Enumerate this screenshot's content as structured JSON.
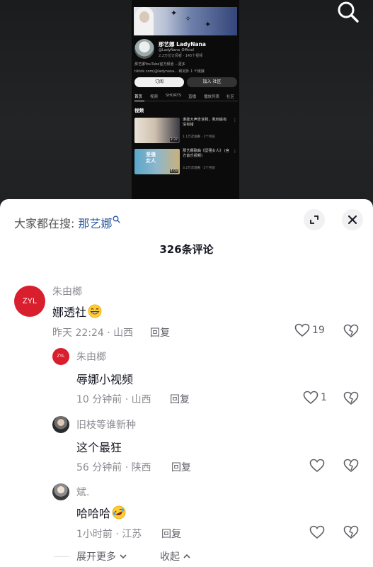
{
  "video": {
    "channel_name": "那艺娜 LadyNana",
    "handle": "@LadyNana_Official",
    "stats": "2.2万位订阅者 · 145个视频",
    "description": "那艺娜YouTube官方频道 ...更多",
    "link": "tiktok.com/@ladynana... 和另外 1 个链接",
    "subscribe_label": "订阅",
    "join_label": "加入 社区",
    "tabs": [
      "首页",
      "视频",
      "SHORTS",
      "直播",
      "播放列表",
      "社区"
    ],
    "section_title": "视频",
    "videos": [
      {
        "title": "谁能大声告诉我，我到底有没有错",
        "meta": "1.1万次观看 · 1个月前",
        "duration": "2:37",
        "thumb_text": ""
      },
      {
        "title": "那艺娜歌曲《坚强女人》 (官方音乐视频)",
        "meta": "3.2万次观看 · 2个月前",
        "duration": "4:03",
        "thumb_text": "坚强\n女人"
      }
    ]
  },
  "sheet": {
    "everyone_searching_prefix": "大家都在搜:",
    "search_term": "那艺娜",
    "comment_count": "326条评论"
  },
  "comments": [
    {
      "avatar_text": "ZYL",
      "username": "朱由榔",
      "text": "娜透社",
      "emoji": "grin",
      "meta": "昨天 22:24 · 山西",
      "reply": "回复",
      "likes": "19"
    },
    {
      "avatar_text": "ZYL",
      "username": "朱由榔",
      "text": "辱娜小视频",
      "emoji": "",
      "meta": "10 分钟前 · 山西",
      "reply": "回复",
      "likes": "1"
    },
    {
      "avatar_text": "",
      "username": "旧枝等谁新种",
      "text": "这个最狂",
      "emoji": "",
      "meta": "56 分钟前 · 陕西",
      "reply": "回复",
      "likes": ""
    },
    {
      "avatar_text": "",
      "username": "斌.",
      "text": "哈哈哈",
      "emoji": "rofl",
      "meta": "1小时前 · 江苏",
      "reply": "回复",
      "likes": ""
    }
  ],
  "footer": {
    "expand_more": "展开更多",
    "collapse": "收起"
  },
  "colors": {
    "accent_search": "#2f5f9f",
    "avatar_red": "#d91e2d"
  }
}
